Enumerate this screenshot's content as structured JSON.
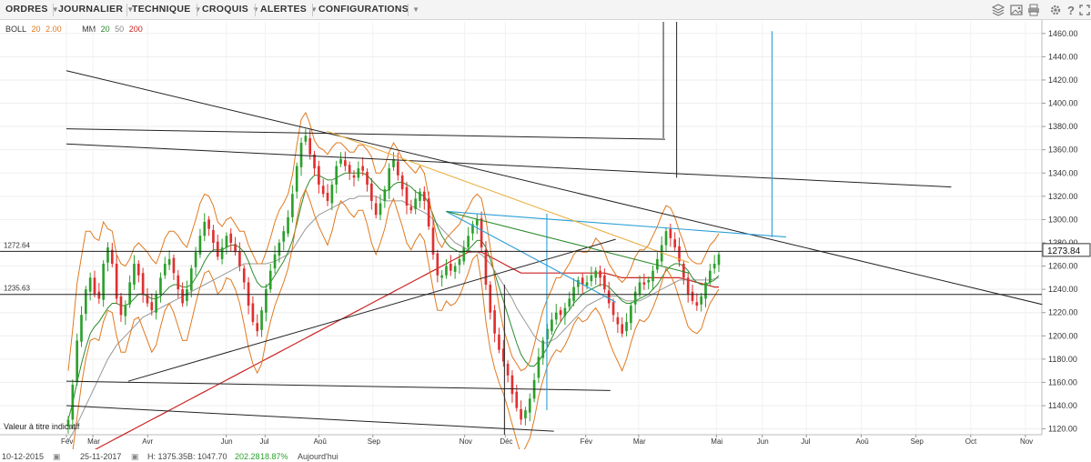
{
  "toolbar": {
    "menus": [
      {
        "label": "ORDRES"
      },
      {
        "label": "JOURNALIER"
      },
      {
        "label": "TECHNIQUE"
      },
      {
        "label": "CROQUIS"
      },
      {
        "label": "ALERTES"
      },
      {
        "label": "CONFIGURATIONS"
      }
    ],
    "icons": [
      "layers-icon",
      "image-icon",
      "print-icon",
      "gear-icon",
      "help-icon",
      "expand-icon"
    ]
  },
  "legend": {
    "boll_label": "BOLL",
    "boll_period": "20",
    "boll_dev": "2.00",
    "mm_label": "MM",
    "mm_p1": "20",
    "mm_p2": "50",
    "mm_p3": "200"
  },
  "colors": {
    "up": "#2ca02c",
    "down": "#e03030",
    "boll": "#e07a20",
    "mm20": "#2e8b2e",
    "mm50": "#999999",
    "mm200": "#cc2222",
    "trend": "#222222",
    "fib": "#2a9fd6",
    "fan": "#e8b040"
  },
  "chart_data": {
    "type": "candlestick",
    "ylim": [
      1115,
      1470
    ],
    "y_ticks": [
      1120,
      1140,
      1160,
      1180,
      1200,
      1220,
      1240,
      1260,
      1280,
      1300,
      1320,
      1340,
      1360,
      1380,
      1400,
      1420,
      1440,
      1460
    ],
    "y_tick_labels": [
      "1120.00",
      "1140.00",
      "1160.00",
      "1180.00",
      "1200.00",
      "1220.00",
      "1240.00",
      "1260.00",
      "1280.00",
      "1300.00",
      "1320.00",
      "1340.00",
      "1360.00",
      "1380.00",
      "1400.00",
      "1420.00",
      "1440.00",
      "1460.00"
    ],
    "x_labels": [
      "Fév",
      "Mar",
      "Avr",
      "Jun",
      "Jul",
      "Aoû",
      "Sep",
      "Nov",
      "Déc",
      "Fév",
      "Mar",
      "Mai",
      "Jun",
      "Jul",
      "Aoû",
      "Sep",
      "Oct",
      "Nov"
    ],
    "x_label_days": [
      0,
      30,
      92,
      181,
      225,
      286,
      347,
      451,
      497,
      588,
      648,
      736,
      788,
      838,
      900,
      962,
      1024,
      1086
    ],
    "current_price": "1273.84",
    "horizontal_levels": [
      {
        "value": 1272.64,
        "label": "1272.64"
      },
      {
        "value": 1235.63,
        "label": "1235.63"
      }
    ],
    "note": "Valeur à titre indicatif",
    "footer": {
      "start_date": "10-12-2015",
      "end_date": "25-11-2017",
      "high": "H: 1375.35",
      "low": "B: 1047.70",
      "change": "202.28",
      "change_pct": "18.87%",
      "today": "Aujourd'hui"
    },
    "closes": [
      1128,
      1158,
      1196,
      1218,
      1240,
      1250,
      1236,
      1232,
      1262,
      1276,
      1262,
      1232,
      1218,
      1226,
      1246,
      1262,
      1252,
      1236,
      1228,
      1222,
      1236,
      1250,
      1262,
      1266,
      1254,
      1240,
      1228,
      1240,
      1258,
      1272,
      1286,
      1298,
      1292,
      1280,
      1268,
      1276,
      1286,
      1280,
      1272,
      1260,
      1246,
      1226,
      1212,
      1204,
      1222,
      1240,
      1256,
      1270,
      1280,
      1290,
      1302,
      1322,
      1346,
      1366,
      1372,
      1356,
      1344,
      1330,
      1322,
      1316,
      1330,
      1346,
      1352,
      1346,
      1340,
      1336,
      1344,
      1342,
      1330,
      1316,
      1304,
      1314,
      1326,
      1344,
      1352,
      1338,
      1326,
      1312,
      1308,
      1318,
      1324,
      1316,
      1294,
      1270,
      1252,
      1252,
      1260,
      1256,
      1260,
      1266,
      1276,
      1286,
      1296,
      1300,
      1276,
      1244,
      1220,
      1202,
      1188,
      1178,
      1166,
      1150,
      1138,
      1128,
      1136,
      1146,
      1162,
      1182,
      1196,
      1206,
      1214,
      1220,
      1218,
      1224,
      1232,
      1242,
      1248,
      1244,
      1246,
      1252,
      1256,
      1250,
      1240,
      1228,
      1218,
      1210,
      1202,
      1212,
      1226,
      1238,
      1246,
      1244,
      1248,
      1256,
      1266,
      1278,
      1290,
      1284,
      1276,
      1264,
      1250,
      1236,
      1230,
      1226,
      1234,
      1246,
      1256,
      1262,
      1270
    ],
    "boll_upper": [
      1170,
      1205,
      1245,
      1268,
      1290,
      1290,
      1284,
      1282,
      1298,
      1292,
      1290,
      1270,
      1262,
      1260,
      1266,
      1276,
      1280,
      1276,
      1272,
      1266,
      1262,
      1272,
      1284,
      1290,
      1290,
      1286,
      1280,
      1276,
      1288,
      1300,
      1314,
      1322,
      1320,
      1312,
      1298,
      1294,
      1300,
      1302,
      1296,
      1290,
      1290,
      1278,
      1270,
      1262,
      1262,
      1272,
      1284,
      1298,
      1308,
      1314,
      1322,
      1338,
      1364,
      1386,
      1392,
      1382,
      1368,
      1362,
      1360,
      1356,
      1362,
      1366,
      1366,
      1362,
      1358,
      1358,
      1364,
      1364,
      1360,
      1354,
      1340,
      1340,
      1346,
      1358,
      1366,
      1360,
      1352,
      1348,
      1344,
      1340,
      1346,
      1340,
      1320,
      1300,
      1282,
      1276,
      1284,
      1288,
      1292,
      1296,
      1304,
      1310,
      1318,
      1322,
      1318,
      1300,
      1276,
      1250,
      1226,
      1206,
      1194,
      1182,
      1176,
      1170,
      1172,
      1178,
      1192,
      1208,
      1222,
      1232,
      1240,
      1250,
      1250,
      1256,
      1262,
      1270,
      1274,
      1272,
      1272,
      1276,
      1284,
      1280,
      1272,
      1262,
      1256,
      1250,
      1246,
      1250,
      1258,
      1268,
      1274,
      1274,
      1278,
      1286,
      1294,
      1304,
      1312,
      1310,
      1302,
      1290,
      1280,
      1268,
      1264,
      1262,
      1262,
      1270,
      1278,
      1282,
      1288
    ],
    "boll_lower": [
      1088,
      1100,
      1130,
      1158,
      1180,
      1196,
      1198,
      1196,
      1212,
      1222,
      1220,
      1200,
      1186,
      1186,
      1200,
      1214,
      1216,
      1206,
      1196,
      1186,
      1192,
      1208,
      1222,
      1228,
      1220,
      1208,
      1196,
      1196,
      1212,
      1228,
      1242,
      1254,
      1256,
      1248,
      1236,
      1240,
      1250,
      1248,
      1240,
      1228,
      1210,
      1190,
      1176,
      1168,
      1176,
      1196,
      1212,
      1226,
      1236,
      1246,
      1258,
      1276,
      1300,
      1318,
      1326,
      1316,
      1304,
      1294,
      1286,
      1278,
      1290,
      1306,
      1316,
      1312,
      1306,
      1302,
      1308,
      1308,
      1296,
      1280,
      1270,
      1280,
      1292,
      1310,
      1318,
      1306,
      1294,
      1280,
      1274,
      1282,
      1288,
      1282,
      1262,
      1240,
      1222,
      1222,
      1230,
      1226,
      1228,
      1234,
      1244,
      1254,
      1266,
      1270,
      1246,
      1212,
      1188,
      1172,
      1160,
      1150,
      1138,
      1124,
      1110,
      1098,
      1104,
      1112,
      1128,
      1148,
      1162,
      1174,
      1182,
      1188,
      1186,
      1192,
      1200,
      1210,
      1216,
      1212,
      1214,
      1220,
      1224,
      1218,
      1208,
      1196,
      1186,
      1178,
      1170,
      1180,
      1194,
      1206,
      1214,
      1212,
      1216,
      1224,
      1234,
      1246,
      1258,
      1252,
      1244,
      1232,
      1220,
      1208,
      1204,
      1202,
      1206,
      1218,
      1228,
      1234,
      1240
    ],
    "mm20": [
      1128,
      1142,
      1160,
      1176,
      1190,
      1202,
      1208,
      1212,
      1218,
      1224,
      1228,
      1228,
      1226,
      1226,
      1228,
      1232,
      1236,
      1236,
      1234,
      1232,
      1232,
      1234,
      1238,
      1242,
      1244,
      1244,
      1242,
      1242,
      1244,
      1250,
      1256,
      1264,
      1270,
      1274,
      1274,
      1274,
      1276,
      1278,
      1278,
      1276,
      1272,
      1264,
      1254,
      1246,
      1242,
      1242,
      1246,
      1252,
      1258,
      1264,
      1272,
      1282,
      1296,
      1312,
      1326,
      1334,
      1338,
      1338,
      1336,
      1334,
      1334,
      1336,
      1338,
      1340,
      1340,
      1340,
      1340,
      1340,
      1338,
      1334,
      1330,
      1326,
      1324,
      1326,
      1330,
      1332,
      1332,
      1330,
      1328,
      1324,
      1322,
      1320,
      1314,
      1304,
      1294,
      1286,
      1280,
      1276,
      1274,
      1272,
      1272,
      1274,
      1278,
      1282,
      1282,
      1276,
      1266,
      1254,
      1242,
      1230,
      1218,
      1206,
      1194,
      1184,
      1178,
      1174,
      1174,
      1178,
      1184,
      1190,
      1198,
      1206,
      1212,
      1218,
      1222,
      1228,
      1232,
      1236,
      1238,
      1240,
      1242,
      1244,
      1244,
      1242,
      1238,
      1234,
      1230,
      1228,
      1228,
      1230,
      1232,
      1234,
      1236,
      1240,
      1244,
      1250,
      1256,
      1260,
      1262,
      1262,
      1260,
      1256,
      1250,
      1246,
      1244,
      1244,
      1246,
      1248,
      1252
    ],
    "mm50": [
      1110,
      1116,
      1124,
      1132,
      1140,
      1148,
      1156,
      1164,
      1172,
      1180,
      1186,
      1192,
      1196,
      1200,
      1204,
      1208,
      1212,
      1216,
      1218,
      1220,
      1222,
      1224,
      1226,
      1228,
      1230,
      1232,
      1234,
      1236,
      1238,
      1240,
      1242,
      1244,
      1246,
      1248,
      1250,
      1252,
      1254,
      1256,
      1258,
      1260,
      1262,
      1262,
      1262,
      1262,
      1262,
      1262,
      1263,
      1264,
      1266,
      1268,
      1270,
      1274,
      1280,
      1286,
      1292,
      1296,
      1300,
      1304,
      1306,
      1308,
      1310,
      1312,
      1314,
      1316,
      1318,
      1318,
      1320,
      1320,
      1320,
      1320,
      1320,
      1318,
      1316,
      1316,
      1316,
      1316,
      1316,
      1314,
      1312,
      1310,
      1308,
      1306,
      1304,
      1300,
      1296,
      1292,
      1288,
      1284,
      1280,
      1278,
      1276,
      1274,
      1272,
      1272,
      1270,
      1266,
      1262,
      1256,
      1250,
      1244,
      1238,
      1232,
      1224,
      1218,
      1212,
      1206,
      1200,
      1196,
      1194,
      1194,
      1196,
      1198,
      1202,
      1206,
      1210,
      1214,
      1218,
      1222,
      1226,
      1228,
      1230,
      1232,
      1234,
      1234,
      1234,
      1234,
      1232,
      1230,
      1230,
      1230,
      1230,
      1232,
      1234,
      1236,
      1238,
      1240,
      1242,
      1244,
      1246,
      1248,
      1248,
      1248,
      1248,
      1248,
      1248,
      1248,
      1248,
      1249,
      1250
    ],
    "mm200": [
      1090,
      1092,
      1094,
      1096,
      1098,
      1100,
      1102,
      1104,
      1106,
      1108,
      1110,
      1112,
      1114,
      1116,
      1118,
      1120,
      1122,
      1124,
      1126,
      1128,
      1130,
      1132,
      1134,
      1136,
      1138,
      1140,
      1142,
      1144,
      1146,
      1148,
      1150,
      1152,
      1154,
      1156,
      1158,
      1160,
      1162,
      1164,
      1166,
      1168,
      1170,
      1172,
      1174,
      1176,
      1178,
      1180,
      1182,
      1184,
      1186,
      1188,
      1190,
      1192,
      1194,
      1196,
      1198,
      1200,
      1202,
      1204,
      1206,
      1208,
      1210,
      1212,
      1214,
      1216,
      1218,
      1220,
      1222,
      1224,
      1226,
      1228,
      1230,
      1232,
      1234,
      1236,
      1238,
      1240,
      1242,
      1244,
      1246,
      1248,
      1250,
      1252,
      1254,
      1256,
      1258,
      1260,
      1262,
      1264,
      1266,
      1268,
      1270,
      1272,
      1272,
      1272,
      1272,
      1270,
      1268,
      1266,
      1264,
      1262,
      1260,
      1258,
      1256,
      1254,
      1254,
      1254,
      1254,
      1254,
      1254,
      1254,
      1254,
      1254,
      1254,
      1254,
      1254,
      1254,
      1254,
      1254,
      1254,
      1254,
      1254,
      1254,
      1254,
      1253,
      1252,
      1251,
      1250,
      1250,
      1250,
      1250,
      1250,
      1250,
      1250,
      1250,
      1250,
      1250,
      1250,
      1250,
      1250,
      1250,
      1249,
      1248,
      1247,
      1246,
      1245,
      1244,
      1243,
      1242,
      1242
    ],
    "trendlines": [
      {
        "x1": 0,
        "y1": 1428,
        "x2": 1105,
        "y2": 1227,
        "color": "trend"
      },
      {
        "x1": 0,
        "y1": 1378,
        "x2": 678,
        "y2": 1369,
        "color": "trend"
      },
      {
        "x1": 0,
        "y1": 1365,
        "x2": 1002,
        "y2": 1328,
        "color": "trend"
      },
      {
        "x1": 0,
        "y1": 1161,
        "x2": 616,
        "y2": 1153,
        "color": "trend"
      },
      {
        "x1": 0,
        "y1": 1140,
        "x2": 552,
        "y2": 1118,
        "color": "trend"
      },
      {
        "x1": 70,
        "y1": 1161,
        "x2": 622,
        "y2": 1283,
        "color": "trend"
      },
      {
        "x1": 676,
        "y1": 1370,
        "x2": 676,
        "y2": 1470,
        "color": "trend"
      },
      {
        "x1": 691,
        "y1": 1336,
        "x2": 691,
        "y2": 1470,
        "color": "trend"
      },
      {
        "x1": 496,
        "y1": 1115,
        "x2": 496,
        "y2": 1244,
        "color": "trend"
      },
      {
        "x1": 495,
        "y1": 1154,
        "x2": 496,
        "y2": 1154,
        "color": "trend"
      },
      {
        "x1": 430,
        "y1": 1307,
        "x2": 622,
        "y2": 1229,
        "color": "fib"
      },
      {
        "x1": 430,
        "y1": 1307,
        "x2": 815,
        "y2": 1285,
        "color": "fib"
      },
      {
        "x1": 544,
        "y1": 1305,
        "x2": 544,
        "y2": 1136,
        "color": "fib"
      },
      {
        "x1": 799,
        "y1": 1285,
        "x2": 799,
        "y2": 1462,
        "color": "fib"
      },
      {
        "x1": 295,
        "y1": 1376,
        "x2": 705,
        "y2": 1263,
        "color": "fan"
      },
      {
        "x1": 430,
        "y1": 1307,
        "x2": 705,
        "y2": 1254,
        "color": "mm20"
      }
    ]
  }
}
